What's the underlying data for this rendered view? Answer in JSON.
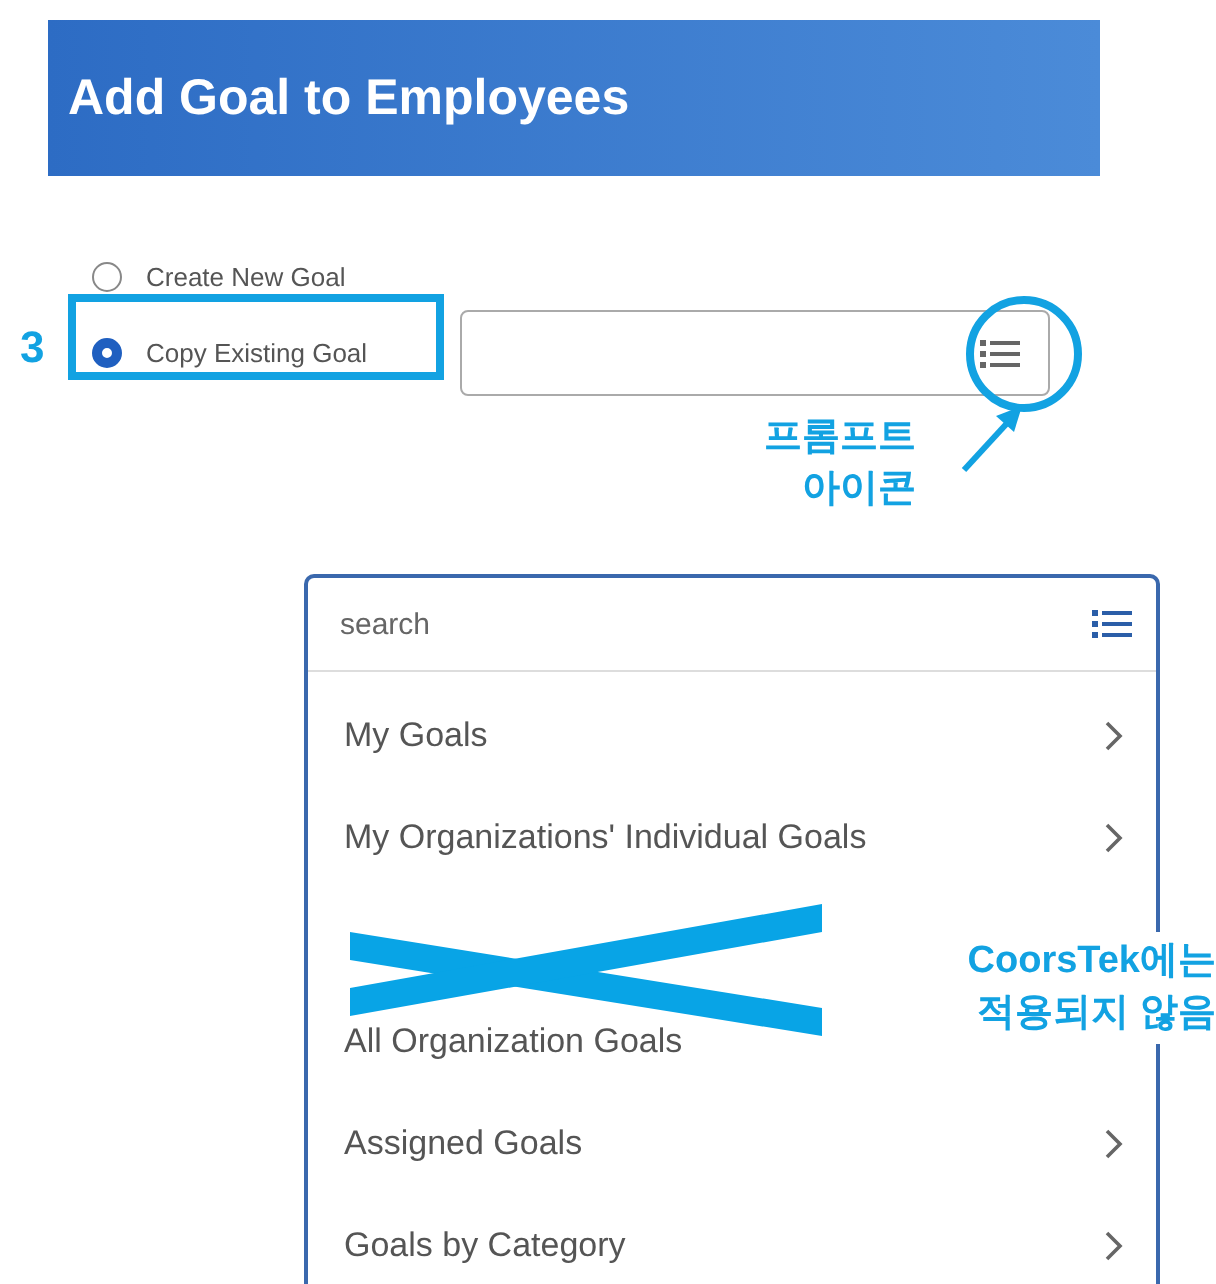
{
  "header": {
    "title": "Add Goal to Employees"
  },
  "options": [
    {
      "label": "Create New Goal",
      "selected": false
    },
    {
      "label": "Copy Existing Goal",
      "selected": true
    }
  ],
  "prompt_menu": {
    "placeholder": "search",
    "items": [
      {
        "kind": "submenu",
        "label": "My Goals"
      },
      {
        "kind": "submenu",
        "label": "My Organizations' Individual Goals"
      },
      {
        "kind": "crossed"
      },
      {
        "kind": "plain",
        "label": "All Organization Goals"
      },
      {
        "kind": "submenu",
        "label": "Assigned Goals"
      },
      {
        "kind": "submenu",
        "label": "Goals by Category"
      }
    ]
  },
  "annotations": {
    "step": "3",
    "prompt_callout": "프롬프트\n아이콘",
    "crossed_note": "CoorsTek에는\n적용되지 않음"
  }
}
